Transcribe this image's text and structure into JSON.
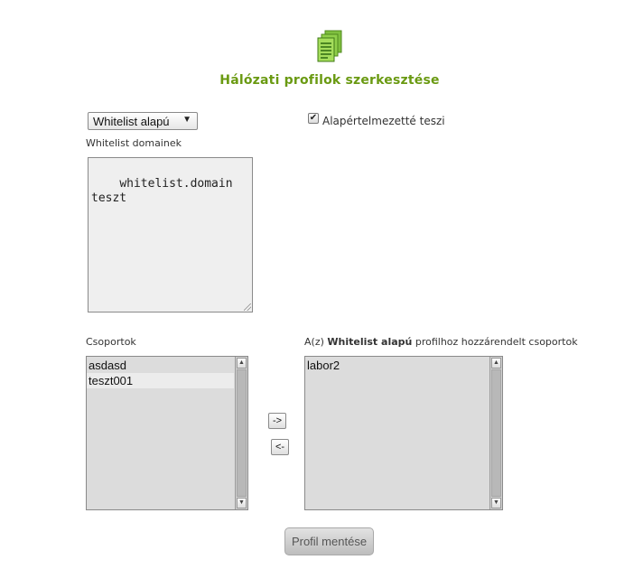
{
  "header": {
    "icon": "documents-icon",
    "title": "Hálózati profilok szerkesztése",
    "accent_color": "#6a9a12"
  },
  "profile_type": {
    "selected": "Whitelist alapú"
  },
  "default_option": {
    "label": "Alapértelmezetté teszi",
    "checked": true,
    "mark": "✔"
  },
  "domains": {
    "label": "Whitelist domainek",
    "value": "whitelist.domain\nteszt"
  },
  "groups": {
    "label": "Csoportok",
    "items": [
      "asdasd",
      "teszt001"
    ]
  },
  "assigned": {
    "label_prefix": "A(z) ",
    "label_bold": "Whitelist alapú",
    "label_suffix": " profilhoz hozzárendelt csoportok",
    "items": [
      "labor2"
    ]
  },
  "controls": {
    "add_label": "->",
    "remove_label": "<-",
    "save_label": "Profil mentése",
    "select_arrow": "▼",
    "scroll_up": "▲",
    "scroll_down": "▼"
  }
}
